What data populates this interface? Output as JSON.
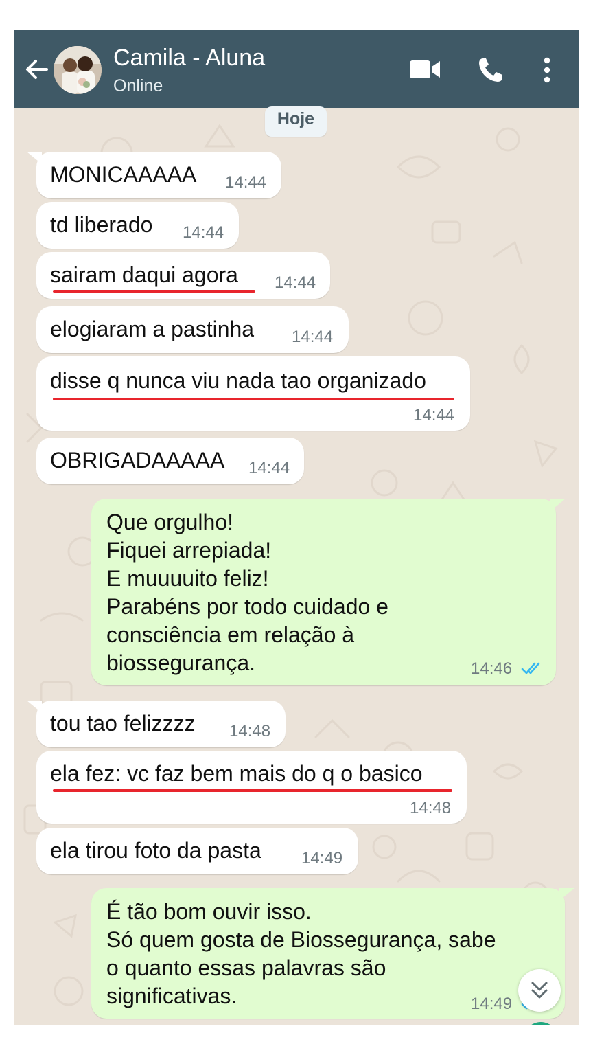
{
  "header": {
    "contact_name": "Camila - Aluna",
    "status": "Online",
    "colors": {
      "bar": "#3f5966"
    },
    "icons": [
      "back-arrow-icon",
      "video-call-icon",
      "voice-call-icon",
      "more-options-icon"
    ]
  },
  "date_chip": "Hoje",
  "messages": [
    {
      "direction": "in",
      "text": "MONICAAAAA",
      "time": "14:44"
    },
    {
      "direction": "in",
      "text": "td liberado",
      "time": "14:44"
    },
    {
      "direction": "in",
      "text": "sairam daqui agora",
      "time": "14:44",
      "underlined": true
    },
    {
      "direction": "in",
      "text": "elogiaram a pastinha",
      "time": "14:44"
    },
    {
      "direction": "in",
      "text": "disse q nunca viu nada tao organizado",
      "time": "14:44",
      "underlined": true
    },
    {
      "direction": "in",
      "text": "OBRIGADAAAAA",
      "time": "14:44"
    },
    {
      "direction": "out",
      "lines": [
        "Que orgulho!",
        "Fiquei arrepiada!",
        "E muuuuito feliz!",
        "Parabéns por todo cuidado e",
        "consciência em relação à",
        "biossegurança."
      ],
      "time": "14:46",
      "status": "read"
    },
    {
      "direction": "in",
      "text": "tou tao felizzzz",
      "time": "14:48"
    },
    {
      "direction": "in",
      "text": "ela fez: vc faz bem mais do q o basico",
      "time": "14:48",
      "underlined": true
    },
    {
      "direction": "in",
      "text": "ela tirou foto da pasta",
      "time": "14:49"
    },
    {
      "direction": "out",
      "lines": [
        "É tão bom ouvir isso.",
        "Só quem gosta de Biossegurança, sabe",
        "o quanto essas palavras são",
        "significativas."
      ],
      "time": "14:49",
      "status": "read"
    }
  ],
  "colors": {
    "chat_background": "#ebe3d9",
    "incoming_bubble": "#ffffff",
    "outgoing_bubble": "#e1fcd0",
    "read_ticks": "#34b7f1",
    "annotation_underline": "#e8252d"
  },
  "scroll_down_icon": "double-chevron-down-icon"
}
